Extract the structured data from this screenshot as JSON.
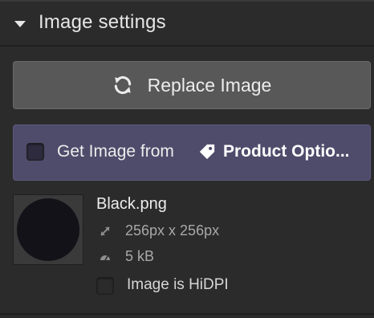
{
  "section": {
    "title": "Image settings"
  },
  "replace_button": {
    "label": "Replace Image",
    "icon": "refresh-icon"
  },
  "dynamic_source": {
    "label": "Get Image from",
    "source_icon": "tag-icon",
    "source_name": "Product Optio...",
    "checked": false,
    "background": "#4f4b6b"
  },
  "image": {
    "file_name": "Black.png",
    "dimensions": "256px x 256px",
    "dimensions_icon": "resize-arrows-icon",
    "size": "5 kB",
    "size_icon": "gauge-icon",
    "thumbnail_color": "#131218"
  },
  "hidpi": {
    "label": "Image is HiDPI",
    "checked": false
  },
  "colors": {
    "panel_bg": "#2b2b2b",
    "button_bg": "#585858",
    "accent_purple": "#4f4b6b"
  }
}
